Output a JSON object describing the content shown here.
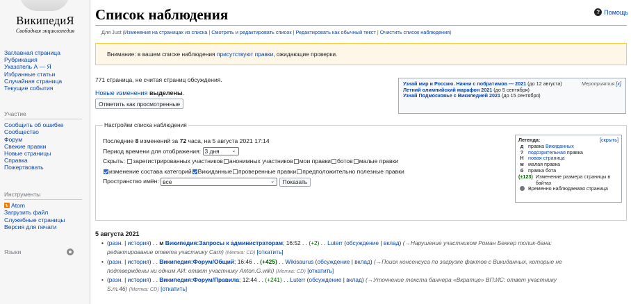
{
  "logo": {
    "title": "ВикипедиЯ",
    "tagline": "Свободная энциклопедия"
  },
  "sidebar": {
    "main": [
      "Заглавная страница",
      "Рубрикация",
      "Указатель А — Я",
      "Избранные статьи",
      "Случайная страница",
      "Текущие события"
    ],
    "participation_heading": "Участие",
    "participation": [
      "Сообщить об ошибке",
      "Сообщество",
      "Форум",
      "Свежие правки",
      "Новые страницы",
      "Справка",
      "Пожертвовать"
    ],
    "tools_heading": "Инструменты",
    "tools": [
      "Atom",
      "Загрузить файл",
      "Служебные страницы",
      "Версия для печати"
    ],
    "languages_heading": "Языки"
  },
  "page": {
    "title": "Список наблюдения",
    "help": "Помощь"
  },
  "subnav": {
    "prefix": "Для Just (",
    "l1": "Изменения на страницах из списка",
    "l2": "Смотреть и редактировать список",
    "l3": "Редактировать как обычный текст",
    "l4": "Очистить список наблюдения",
    "suffix": ")"
  },
  "notice": {
    "pre": "Внимание: в вашем списке наблюдения ",
    "link": "присутствуют правки",
    "post": ", ожидающие проверки."
  },
  "count": "771 страница, не считая страниц обсуждения.",
  "new_changes": {
    "link": "Новые изменения",
    "bold": "выделены",
    "end": "."
  },
  "mark_button": "Отметить как просмотренные",
  "events": {
    "header": "Мероприятия",
    "close": "[x]",
    "e1_title": "Узнай мир и Россию. Начни с побратимов — 2021",
    "e1_date": " (до 12 августа)",
    "e2_title": "Летний олимпийский марафон 2021",
    "e2_date": " (до 5 сентября)",
    "e3_title": "Узнай Подмосковье с Википедией 2021",
    "e3_date": " (до 15 сентября)"
  },
  "settings": {
    "legend": "Настройки списка наблюдения",
    "last_a": "Последние ",
    "last_n": "8",
    "last_b": " изменений за ",
    "last_h": "72",
    "last_c": " часа, на 5 августа 2021 17:14",
    "period_label": "Период времени для отображения: ",
    "period_value": "3 дня",
    "hide_label": "Скрыть: ",
    "hide": [
      "зарегистрированных участников",
      "анонимных участников",
      "мои правки",
      "ботов",
      "малые правки"
    ],
    "hide2": [
      "изменение состава категорий",
      "Викиданные",
      "проверенные правки",
      "предположительно полезные правки"
    ],
    "namespace_label": "Пространство имён: ",
    "namespace_value": "все",
    "show_button": "Показать"
  },
  "legend": {
    "title": "Легенда:",
    "hide": "[скрыть]",
    "d_k": "д",
    "d_pre": "правка ",
    "d_link": "Викиданных",
    "q_k": "?",
    "q_link": "подозрительная",
    "q_post": " правка",
    "n_k": "Н",
    "n_link": "новая страница",
    "m_k": "м",
    "m_t": "малая правка",
    "b_k": "б",
    "b_t": "правка бота",
    "s_k": "(±123)",
    "s_t": "Изменение размера страницы в байтах",
    "t_t": "Временно наблюдаемая страница"
  },
  "date": "5 августа 2021",
  "entries": [
    {
      "diff": "разн.",
      "hist": "история",
      "flag": "м",
      "page": "Википедия:Запросы к администраторам",
      "time": "16:52",
      "delta": "(+2)",
      "user": "Luterr",
      "talk": "обсуждение",
      "contribs": "вклад",
      "summary": "(→Нарушение участником Роман Беккер топик-бана: ",
      "summary_i": "редактирование ответа участнику Carn)",
      "tag": "(Метка: CD)",
      "rollback": "[откатить]"
    },
    {
      "diff": "разн.",
      "hist": "история",
      "page": "Википедия:Форум/Общий",
      "time": "16:46",
      "delta": "(+425)",
      "user": "Wikisaurus",
      "talk": "обсуждение",
      "contribs": "вклад",
      "summary": "(→Поиск консенсуса по загрузке фактов с Викиданных, которые не ",
      "summary_i": "подтверждены ни одним АИ: ответ участнику Anton.G.wiki)",
      "tag": "(Метка: CD)",
      "rollback": "[откатить]"
    },
    {
      "diff": "разн.",
      "hist": "история",
      "page": "Википедия:Форум/Правила",
      "time": "12:44",
      "delta": "(+241)",
      "user": "Luterr",
      "talk": "обсуждение",
      "contribs": "вклад",
      "summary": "(→Уточнение текста баннера «Вкратце» ВП:ИС: ответ участнику ",
      "summary_i": "S.m.46)",
      "tag": "(Метка: CD)",
      "rollback": "[откатить]"
    }
  ]
}
